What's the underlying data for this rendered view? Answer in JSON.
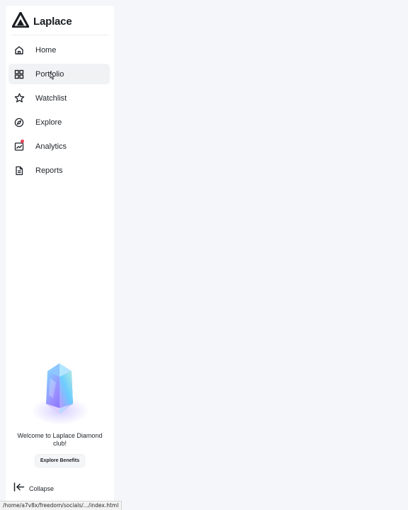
{
  "brand": {
    "name": "Laplace",
    "logo_icon": "laplace-logo-icon"
  },
  "nav": {
    "items": [
      {
        "label": "Home",
        "icon": "home-icon",
        "active": false
      },
      {
        "label": "Portfolio",
        "icon": "portfolio-grid-icon",
        "active": true
      },
      {
        "label": "Watchlist",
        "icon": "star-icon",
        "active": false
      },
      {
        "label": "Explore",
        "icon": "compass-icon",
        "active": false
      },
      {
        "label": "Analytics",
        "icon": "analytics-chart-icon",
        "active": false
      },
      {
        "label": "Reports",
        "icon": "document-icon",
        "active": false
      }
    ]
  },
  "promo": {
    "message": "Welcome to Laplace Diamond club!",
    "button_label": "Explore Benefits",
    "image_icon": "diamond-gem-icon"
  },
  "footer": {
    "collapse_label": "Collapse",
    "collapse_icon": "collapse-arrow-icon"
  },
  "status_bar": {
    "url": "/home/a7v8x/freedom/socials/.../index.html"
  },
  "colors": {
    "notification_dot": "#e8455a",
    "sidebar_bg": "#ffffff",
    "page_bg": "#f4f6fa"
  }
}
